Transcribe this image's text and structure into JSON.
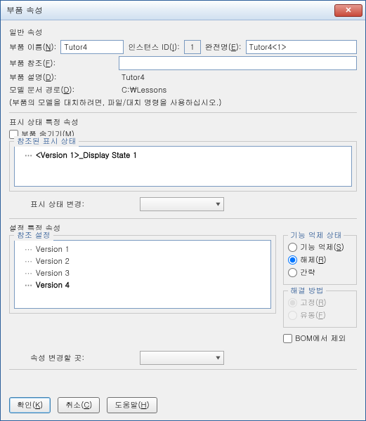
{
  "window": {
    "title": "부품 속성"
  },
  "general": {
    "section_title": "일반 속성",
    "part_name_label": "부품 이름(N):",
    "part_name_value": "Tutor4",
    "instance_id_label": "인스턴스 ID(I):",
    "instance_id_value": "1",
    "full_name_label": "완전명(E):",
    "full_name_value": "Tutor4<1>",
    "part_ref_label": "부품 참조(F):",
    "part_ref_value": "",
    "part_desc_label": "부품 설명(D):",
    "part_desc_value": "Tutor4",
    "model_doc_path_label": "모델 문서 경로(D):",
    "model_doc_path_value": "C:\\Lessons",
    "hint": "(부품의 모델을 대치하려면, 파일/대치 명령을 사용하십시오.)"
  },
  "display_state": {
    "section_title": "표시 상태 특정 속성",
    "hide_part_label": "부품 숨기기(M)",
    "ref_ds_legend": "참조된 표시 상태",
    "items": [
      "<Version 1>_Display State 1"
    ],
    "change_label": "표시 상태 변경:"
  },
  "config": {
    "section_title": "설정 특정 속성",
    "ref_config_legend": "참조 설정",
    "versions": [
      "Version 1",
      "Version 2",
      "Version 3",
      "Version 4"
    ],
    "selected_index": 3,
    "suppress_group_legend": "기능 억제 상태",
    "suppress_options": {
      "suppress": "기능 억제(S)",
      "unsuppress": "해제(R)",
      "omit": "간략"
    },
    "suppress_selected": "unsuppress",
    "solve_group_legend": "해결 방법",
    "solve_options": {
      "fixed": "고정(R)",
      "float": "유동(F)"
    },
    "solve_selected": "fixed",
    "bom_exclude_label": "BOM에서 제외",
    "change_where_label": "속성 변경할 곳:"
  },
  "buttons": {
    "ok": "확인(K)",
    "cancel": "취소(C)",
    "help": "도움말(H)"
  }
}
